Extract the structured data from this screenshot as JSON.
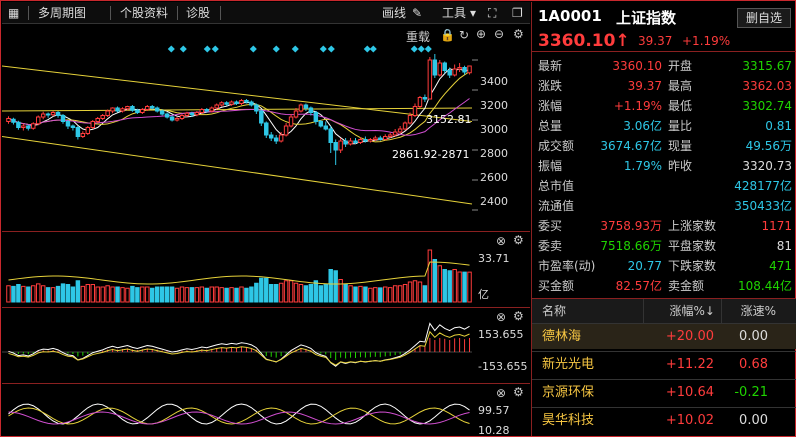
{
  "toolbar": {
    "period": "多周期图",
    "info": "个股资料",
    "diag": "诊股",
    "draw": "画线",
    "tools": "工具",
    "reweight": "重载"
  },
  "chart": {
    "y_ticks": [
      "3400",
      "3200",
      "3000",
      "2800",
      "2600",
      "2400"
    ],
    "y_values": [
      3400,
      3200,
      3000,
      2800,
      2600,
      2400
    ],
    "label_high": "3152.81",
    "label_low": "2861.92-2871",
    "vol_top": "33.71",
    "vol_unit": "亿",
    "macd_top": "153.655",
    "macd_bottom": "-153.655",
    "kdj_top": "99.57",
    "kdj_bottom": "10.28"
  },
  "quote": {
    "code": "1A0001",
    "name": "上证指数",
    "delete_label": "删自选",
    "price": "3360.10",
    "arrow": "↑",
    "change": "39.37",
    "change_pct": "+1.19%",
    "rows": [
      {
        "l": "最新",
        "v": "3360.10",
        "vc": "red",
        "l2": "开盘",
        "v2": "3315.67",
        "v2c": "green"
      },
      {
        "l": "涨跌",
        "v": "39.37",
        "vc": "red",
        "l2": "最高",
        "v2": "3362.03",
        "v2c": "red"
      },
      {
        "l": "涨幅",
        "v": "+1.19%",
        "vc": "red",
        "l2": "最低",
        "v2": "3302.74",
        "v2c": "green"
      },
      {
        "l": "总量",
        "v": "3.06亿",
        "vc": "cyan",
        "l2": "量比",
        "v2": "0.81",
        "v2c": "cyan"
      },
      {
        "l": "成交额",
        "v": "3674.67亿",
        "vc": "cyan",
        "l2": "现量",
        "v2": "49.56万",
        "v2c": "cyan"
      },
      {
        "l": "振幅",
        "v": "1.79%",
        "vc": "cyan",
        "l2": "昨收",
        "v2": "3320.73",
        "v2c": "white"
      },
      {
        "l": "总市值",
        "v": "",
        "vc": "cyan",
        "l2": "",
        "v2": "428177亿",
        "v2c": "cyan"
      },
      {
        "l": "流通值",
        "v": "",
        "vc": "cyan",
        "l2": "",
        "v2": "350433亿",
        "v2c": "cyan"
      },
      {
        "l": "委买",
        "v": "3758.93万",
        "vc": "red",
        "l2": "上涨家数",
        "v2": "1171",
        "v2c": "red"
      },
      {
        "l": "委卖",
        "v": "7518.66万",
        "vc": "green",
        "l2": "平盘家数",
        "v2": "81",
        "v2c": "white"
      },
      {
        "l": "市盈率(动)",
        "v": "20.77",
        "vc": "cyan",
        "l2": "下跌家数",
        "v2": "471",
        "v2c": "green"
      },
      {
        "l": "买金额",
        "v": "82.57亿",
        "vc": "red",
        "l2": "卖金额",
        "v2": "108.44亿",
        "v2c": "green"
      }
    ]
  },
  "table": {
    "headers": [
      "名称",
      "涨幅%↓",
      "涨速%"
    ],
    "rows": [
      {
        "name": "德林海",
        "pct": "+20.00",
        "speed": "0.00",
        "speedc": "white"
      },
      {
        "name": "新光光电",
        "pct": "+11.22",
        "speed": "0.68",
        "speedc": "red"
      },
      {
        "name": "京源环保",
        "pct": "+10.64",
        "speed": "-0.21",
        "speedc": "green"
      },
      {
        "name": "昊华科技",
        "pct": "+10.02",
        "speed": "0.00",
        "speedc": "white"
      }
    ]
  },
  "chart_data": {
    "type": "candlestick",
    "ylim": [
      2300,
      3500
    ],
    "y_ticks": [
      3400,
      3200,
      3000,
      2800,
      2600,
      2400
    ],
    "candles": [
      [
        2990,
        3010,
        2975,
        3025
      ],
      [
        3005,
        2985,
        2970,
        3015
      ],
      [
        2985,
        2950,
        2935,
        2995
      ],
      [
        2950,
        2960,
        2930,
        2975
      ],
      [
        2960,
        2945,
        2930,
        2970
      ],
      [
        2945,
        2975,
        2935,
        2985
      ],
      [
        2975,
        3020,
        2965,
        3030
      ],
      [
        3020,
        3040,
        3005,
        3055
      ],
      [
        3040,
        3035,
        3015,
        3050
      ],
      [
        3035,
        3050,
        3025,
        3060
      ],
      [
        3050,
        3030,
        3015,
        3060
      ],
      [
        3030,
        2990,
        2975,
        3040
      ],
      [
        2990,
        2960,
        2940,
        3000
      ],
      [
        2960,
        2950,
        2930,
        2970
      ],
      [
        2950,
        2890,
        2870,
        2960
      ],
      [
        2890,
        2910,
        2880,
        2925
      ],
      [
        2910,
        2950,
        2900,
        2960
      ],
      [
        2950,
        2990,
        2940,
        3000
      ],
      [
        2990,
        3010,
        2980,
        3020
      ],
      [
        3010,
        3030,
        3000,
        3040
      ],
      [
        3030,
        3060,
        3020,
        3070
      ],
      [
        3060,
        3080,
        3045,
        3085
      ],
      [
        3080,
        3060,
        3050,
        3090
      ],
      [
        3060,
        3075,
        3050,
        3085
      ],
      [
        3075,
        3090,
        3065,
        3095
      ],
      [
        3090,
        3065,
        3055,
        3100
      ],
      [
        3065,
        3050,
        3040,
        3075
      ],
      [
        3050,
        3070,
        3040,
        3080
      ],
      [
        3070,
        3090,
        3060,
        3100
      ],
      [
        3090,
        3080,
        3070,
        3100
      ],
      [
        3080,
        3060,
        3050,
        3090
      ],
      [
        3060,
        3040,
        3030,
        3070
      ],
      [
        3040,
        3020,
        3010,
        3050
      ],
      [
        3020,
        3000,
        2990,
        3030
      ],
      [
        3000,
        3010,
        2990,
        3020
      ],
      [
        3010,
        3030,
        3000,
        3040
      ],
      [
        3030,
        3045,
        3020,
        3055
      ],
      [
        3045,
        3035,
        3020,
        3055
      ],
      [
        3035,
        3050,
        3025,
        3060
      ],
      [
        3050,
        3070,
        3040,
        3080
      ],
      [
        3070,
        3060,
        3050,
        3080
      ],
      [
        3060,
        3080,
        3050,
        3090
      ],
      [
        3080,
        3100,
        3070,
        3110
      ],
      [
        3100,
        3115,
        3090,
        3125
      ],
      [
        3115,
        3105,
        3095,
        3125
      ],
      [
        3105,
        3120,
        3095,
        3130
      ],
      [
        3120,
        3110,
        3100,
        3130
      ],
      [
        3110,
        3130,
        3100,
        3140
      ],
      [
        3130,
        3120,
        3110,
        3140
      ],
      [
        3120,
        3100,
        3090,
        3130
      ],
      [
        3100,
        3060,
        3040,
        3110
      ],
      [
        3060,
        2980,
        2960,
        3070
      ],
      [
        2980,
        2900,
        2880,
        2990
      ],
      [
        2900,
        2880,
        2860,
        2920
      ],
      [
        2880,
        2860,
        2840,
        2900
      ],
      [
        2860,
        2900,
        2850,
        2920
      ],
      [
        2900,
        2960,
        2890,
        2980
      ],
      [
        2960,
        3020,
        2950,
        3040
      ],
      [
        3020,
        3060,
        3010,
        3080
      ],
      [
        3060,
        3100,
        3050,
        3110
      ],
      [
        3100,
        3080,
        3060,
        3110
      ],
      [
        3080,
        3050,
        3030,
        3090
      ],
      [
        3050,
        2990,
        2970,
        3060
      ],
      [
        2990,
        2960,
        2950,
        3000
      ],
      [
        2960,
        2940,
        2930,
        2990
      ],
      [
        2940,
        2850,
        2780,
        2960
      ],
      [
        2850,
        2800,
        2700,
        2870
      ],
      [
        2800,
        2860,
        2780,
        2880
      ],
      [
        2860,
        2840,
        2820,
        2880
      ],
      [
        2840,
        2860,
        2830,
        2880
      ],
      [
        2860,
        2850,
        2840,
        2880
      ],
      [
        2850,
        2870,
        2840,
        2885
      ],
      [
        2870,
        2860,
        2850,
        2890
      ],
      [
        2860,
        2870,
        2850,
        2880
      ],
      [
        2870,
        2880,
        2860,
        2895
      ],
      [
        2880,
        2870,
        2862,
        2895
      ],
      [
        2870,
        2890,
        2865,
        2905
      ],
      [
        2890,
        2900,
        2880,
        2915
      ],
      [
        2900,
        2920,
        2890,
        2940
      ],
      [
        2920,
        2940,
        2910,
        2960
      ],
      [
        2940,
        2980,
        2930,
        2990
      ],
      [
        2980,
        3030,
        2970,
        3050
      ],
      [
        3030,
        3090,
        3020,
        3110
      ],
      [
        3090,
        3150,
        3080,
        3160
      ],
      [
        3150,
        3140,
        3120,
        3170
      ],
      [
        3140,
        3400,
        3140,
        3420
      ],
      [
        3400,
        3300,
        3280,
        3440
      ],
      [
        3300,
        3380,
        3290,
        3400
      ],
      [
        3380,
        3330,
        3310,
        3390
      ],
      [
        3330,
        3300,
        3280,
        3350
      ],
      [
        3300,
        3340,
        3290,
        3370
      ],
      [
        3340,
        3350,
        3320,
        3380
      ],
      [
        3350,
        3320,
        3303,
        3362
      ],
      [
        3315,
        3360,
        3303,
        3362
      ]
    ]
  }
}
